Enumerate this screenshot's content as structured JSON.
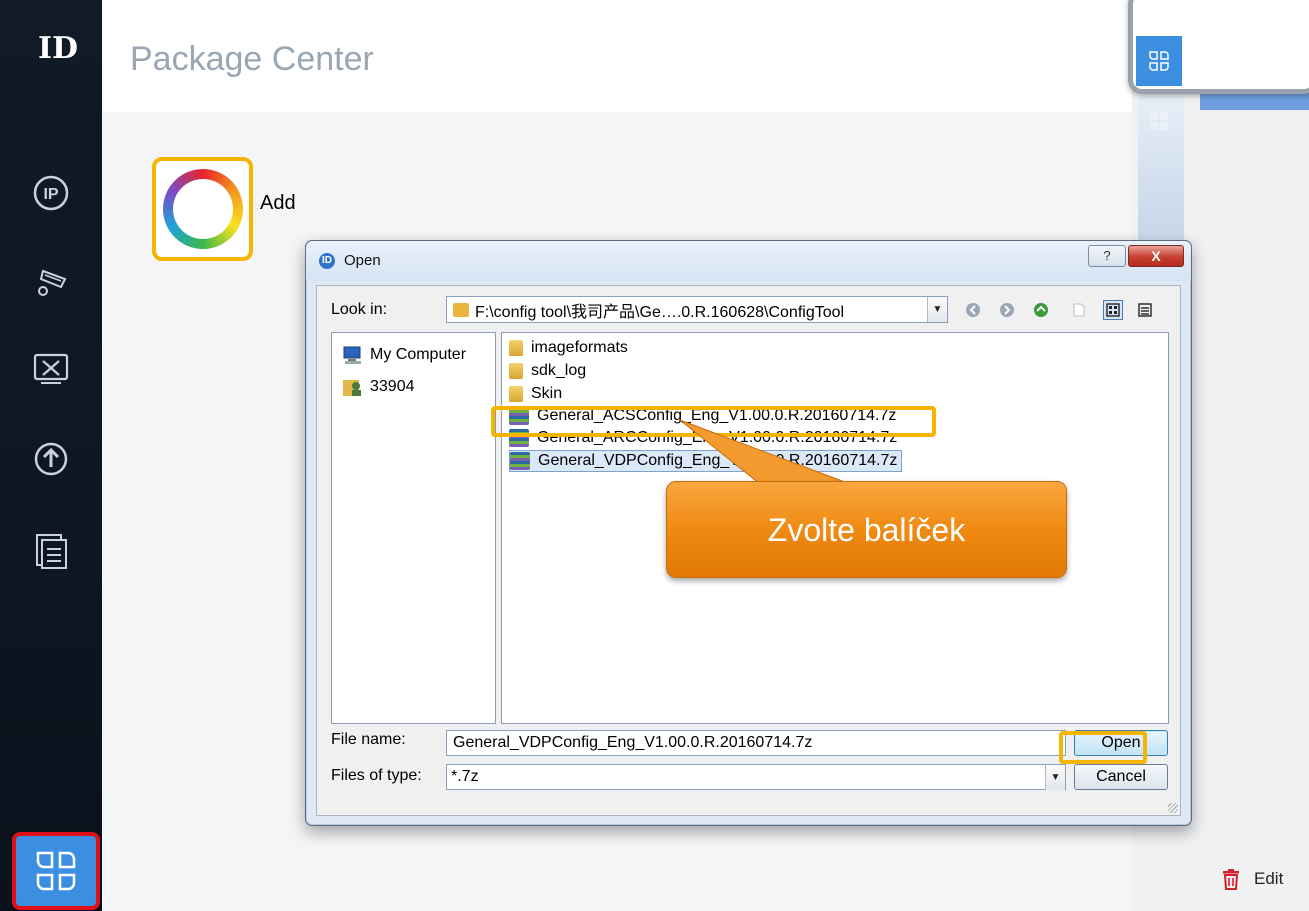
{
  "app": {
    "logo": "ID",
    "page_title": "Package Center",
    "add_label": "Add",
    "edit_label": "Edit"
  },
  "sidebar": {
    "items": [
      {
        "name": "ip-icon"
      },
      {
        "name": "camera-settings-icon"
      },
      {
        "name": "tools-icon"
      },
      {
        "name": "upgrade-icon"
      },
      {
        "name": "document-list-icon"
      },
      {
        "name": "package-center-icon",
        "active": true
      }
    ]
  },
  "dialog": {
    "title": "Open",
    "help_label": "?",
    "close_label": "X",
    "look_in_label": "Look in:",
    "look_in_value": "F:\\config tool\\我司产品\\Ge….0.R.160628\\ConfigTool",
    "places": [
      {
        "label": "My Computer",
        "icon": "computer-icon"
      },
      {
        "label": "33904",
        "icon": "user-folder-icon"
      }
    ],
    "files": [
      {
        "label": "imageformats",
        "type": "folder"
      },
      {
        "label": "sdk_log",
        "type": "folder"
      },
      {
        "label": "Skin",
        "type": "folder"
      },
      {
        "label": "General_ACSConfig_Eng_V1.00.0.R.20160714.7z",
        "type": "archive"
      },
      {
        "label": "General_ARCConfig_Eng_V1.00.0.R.20160714.7z",
        "type": "archive"
      },
      {
        "label": "General_VDPConfig_Eng_V1.00.0.R.20160714.7z",
        "type": "archive",
        "selected": true
      }
    ],
    "file_name_label": "File name:",
    "file_name_value": "General_VDPConfig_Eng_V1.00.0.R.20160714.7z",
    "files_of_type_label": "Files of type:",
    "files_of_type_value": "*.7z",
    "open_label": "Open",
    "cancel_label": "Cancel"
  },
  "tutorial": {
    "callout_text": "Zvolte balíček",
    "highlight_color": "#f6b400",
    "active_highlight_color": "#e0101a"
  },
  "colors": {
    "accent": "#3c8fe0",
    "callout": "#ef8a12"
  }
}
